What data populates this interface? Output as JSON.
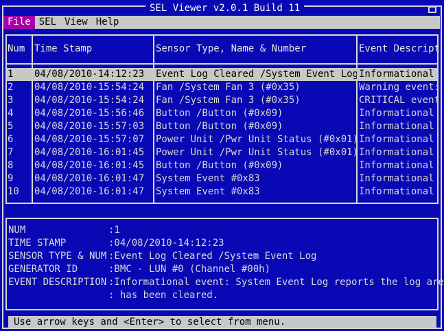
{
  "window": {
    "title": "SEL Viewer v2.0.1 Build 11"
  },
  "menu": [
    {
      "label": "File",
      "active": true
    },
    {
      "label": "SEL",
      "active": false
    },
    {
      "label": "View",
      "active": false
    },
    {
      "label": "Help",
      "active": false
    }
  ],
  "table": {
    "headers": [
      "Num",
      "Time Stamp",
      "Sensor Type, Name & Number",
      "Event Descript"
    ],
    "rows": [
      [
        "1",
        "04/08/2010-14:12:23",
        "Event Log Cleared /System Event Log",
        "Informational"
      ],
      [
        "2",
        "04/08/2010-15:54:24",
        "Fan /System Fan 3 (#0x35)",
        "Warning event:"
      ],
      [
        "3",
        "04/08/2010-15:54:24",
        "Fan /System Fan 3 (#0x35)",
        "CRITICAL event"
      ],
      [
        "4",
        "04/08/2010-15:56:46",
        "Button /Button (#0x09)",
        "Informational"
      ],
      [
        "5",
        "04/08/2010-15:57:03",
        "Button /Button (#0x09)",
        "Informational"
      ],
      [
        "6",
        "04/08/2010-15:57:07",
        "Power Unit /Pwr Unit Status (#0x01)",
        "Informational"
      ],
      [
        "7",
        "04/08/2010-16:01:45",
        "Power Unit /Pwr Unit Status (#0x01)",
        "Informational"
      ],
      [
        "8",
        "04/08/2010-16:01:45",
        "Button /Button (#0x09)",
        "Informational"
      ],
      [
        "9",
        "04/08/2010-16:01:47",
        "System Event #0x83",
        "Informational"
      ],
      [
        "10",
        "04/08/2010-16:01:47",
        "System Event #0x83",
        "Informational"
      ]
    ],
    "selected_row": 0
  },
  "detail": [
    {
      "label": "NUM",
      "value": ":1"
    },
    {
      "label": "TIME STAMP",
      "value": ":04/08/2010-14:12:23"
    },
    {
      "label": "SENSOR TYPE & NUM",
      "value": ":Event Log Cleared /System Event Log"
    },
    {
      "label": "GENERATOR ID",
      "value": ":BMC - LUN #0 (Channel #00h)"
    },
    {
      "label": "EVENT DESCRIPTION",
      "value": ":Informational event: System Event Log reports the log area"
    },
    {
      "label": "",
      "value": ": has been cleared."
    }
  ],
  "status": {
    "text": "Use arrow keys and <Enter> to select from menu."
  },
  "colors": {
    "background": "#0808b4",
    "text": "#d8d8d8",
    "highlight": "#c8c8c8",
    "menu_active": "#a800a8"
  }
}
